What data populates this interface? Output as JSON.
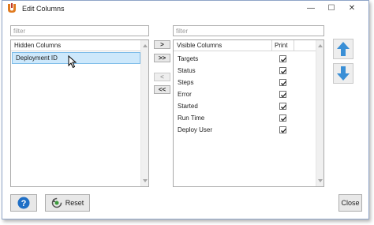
{
  "window": {
    "title": "Edit Columns",
    "controls": {
      "minimize": "—",
      "maximize": "☐",
      "close": "✕"
    }
  },
  "hidden_panel": {
    "filter_placeholder": "filter",
    "header": "Hidden Columns",
    "items": [
      {
        "label": "Deployment ID",
        "selected": true
      }
    ]
  },
  "visible_panel": {
    "filter_placeholder": "filter",
    "headers": {
      "name": "Visible Columns",
      "print": "Print"
    },
    "items": [
      {
        "label": "Targets",
        "print": true
      },
      {
        "label": "Status",
        "print": true
      },
      {
        "label": "Steps",
        "print": true
      },
      {
        "label": "Error",
        "print": true
      },
      {
        "label": "Started",
        "print": true
      },
      {
        "label": "Run Time",
        "print": true
      },
      {
        "label": "Deploy User",
        "print": true
      }
    ]
  },
  "move_buttons": {
    "move_right": ">",
    "move_all_right": ">>",
    "move_left": "<",
    "move_all_left": "<<"
  },
  "footer": {
    "help": "?",
    "reset": "Reset",
    "close": "Close"
  },
  "colors": {
    "accent": "#3a8fd6",
    "selection": "#cde8fb",
    "help_button": "#1f6fc6",
    "logo": "#e07a1f"
  }
}
